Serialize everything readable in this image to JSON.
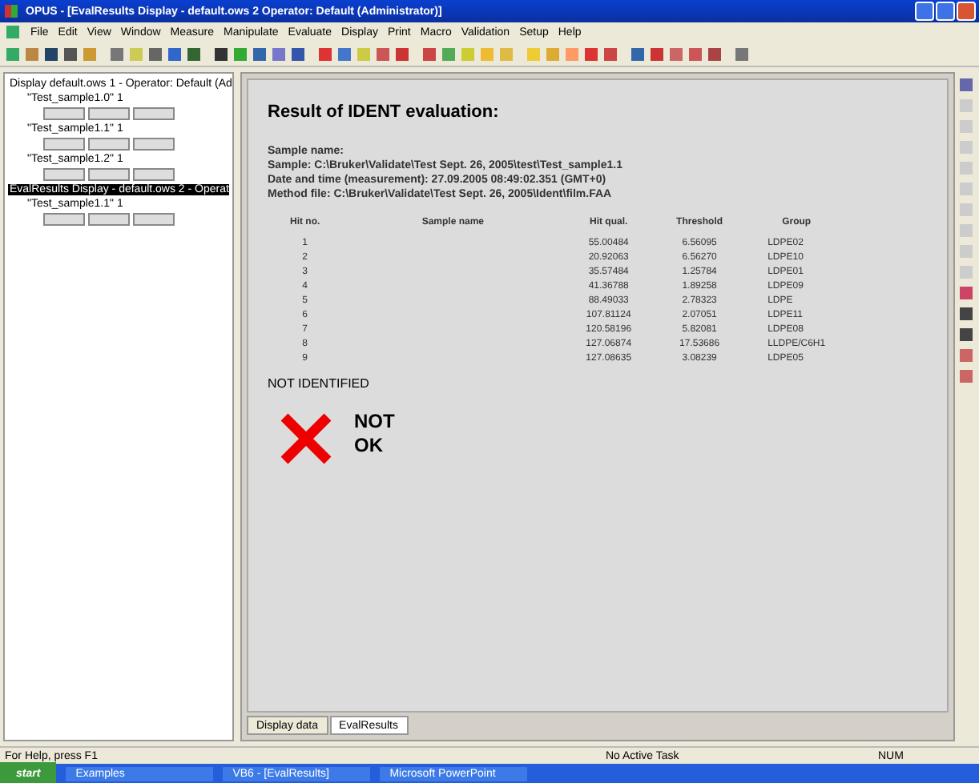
{
  "window": {
    "title": "OPUS - [EvalResults Display - default.ows 2    Operator: Default (Administrator)]"
  },
  "menu": [
    "File",
    "Edit",
    "View",
    "Window",
    "Measure",
    "Manipulate",
    "Evaluate",
    "Display",
    "Print",
    "Macro",
    "Validation",
    "Setup",
    "Help"
  ],
  "tree": [
    {
      "label": "Display default.ows 1 - Operator: Default (Ad",
      "selected": false,
      "children": [
        {
          "label": "\"Test_sample1.0\" 1",
          "selected": false
        },
        {
          "label": "\"Test_sample1.1\" 1",
          "selected": false
        },
        {
          "label": "\"Test_sample1.2\" 1",
          "selected": false
        }
      ]
    },
    {
      "label": "EvalResults Display - default.ows 2 - Operat",
      "selected": true,
      "children": [
        {
          "label": "\"Test_sample1.1\" 1",
          "selected": false
        }
      ]
    }
  ],
  "report": {
    "title": "Result of IDENT evaluation:",
    "info": [
      "Sample name:",
      "Sample:  C:\\Bruker\\Validate\\Test Sept. 26, 2005\\test\\Test_sample1.1",
      "Date and time (measurement):  27.09.2005  08:49:02.351 (GMT+0)",
      "Method file:  C:\\Bruker\\Validate\\Test Sept. 26, 2005\\Ident\\film.FAA"
    ],
    "columns": [
      "Hit no.",
      "Sample name",
      "Hit qual.",
      "Threshold",
      "Group"
    ],
    "rows": [
      [
        "1",
        "",
        "55.00484",
        "6.56095",
        "LDPE02"
      ],
      [
        "2",
        "",
        "20.92063",
        "6.56270",
        "LDPE10"
      ],
      [
        "3",
        "",
        "35.57484",
        "1.25784",
        "LDPE01"
      ],
      [
        "4",
        "",
        "41.36788",
        "1.89258",
        "LDPE09"
      ],
      [
        "5",
        "",
        "88.49033",
        "2.78323",
        "LDPE"
      ],
      [
        "6",
        "",
        "107.81124",
        "2.07051",
        "LDPE11"
      ],
      [
        "7",
        "",
        "120.58196",
        "5.82081",
        "LDPE08"
      ],
      [
        "8",
        "",
        "127.06874",
        "17.53686",
        "LLDPE/C6H1"
      ],
      [
        "9",
        "",
        "127.08635",
        "3.08239",
        "LDPE05"
      ]
    ],
    "verdict": "NOT IDENTIFIED",
    "ok": false,
    "result_label": "NOT OK"
  },
  "doc_tabs": [
    {
      "label": "Display data",
      "selected": false
    },
    {
      "label": "EvalResults",
      "selected": true
    }
  ],
  "status_bar": {
    "help": "For Help, press F1",
    "task": "No Active Task",
    "num": "NUM"
  },
  "taskbar": {
    "start": "start",
    "tasks": [
      "Examples",
      "VB6 - [EvalResults]",
      "Microsoft PowerPoint"
    ]
  }
}
